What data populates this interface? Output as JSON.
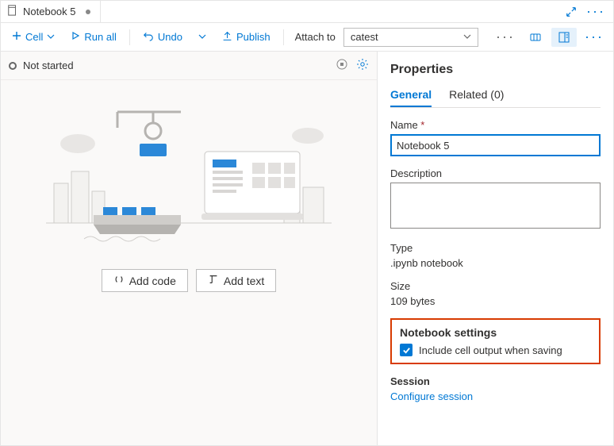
{
  "tab": {
    "title": "Notebook 5"
  },
  "toolbar": {
    "cell": "Cell",
    "run_all": "Run all",
    "undo": "Undo",
    "publish": "Publish",
    "attach_label": "Attach to",
    "attach_value": "catest"
  },
  "status": {
    "text": "Not started"
  },
  "empty": {
    "add_code": "Add code",
    "add_text": "Add text"
  },
  "properties": {
    "heading": "Properties",
    "tabs": {
      "general": "General",
      "related": "Related (0)"
    },
    "name_label": "Name",
    "name_value": "Notebook 5",
    "description_label": "Description",
    "description_value": "",
    "type_label": "Type",
    "type_value": ".ipynb notebook",
    "size_label": "Size",
    "size_value": "109 bytes",
    "settings_title": "Notebook settings",
    "include_output": "Include cell output when saving",
    "session_label": "Session",
    "session_link": "Configure session"
  }
}
